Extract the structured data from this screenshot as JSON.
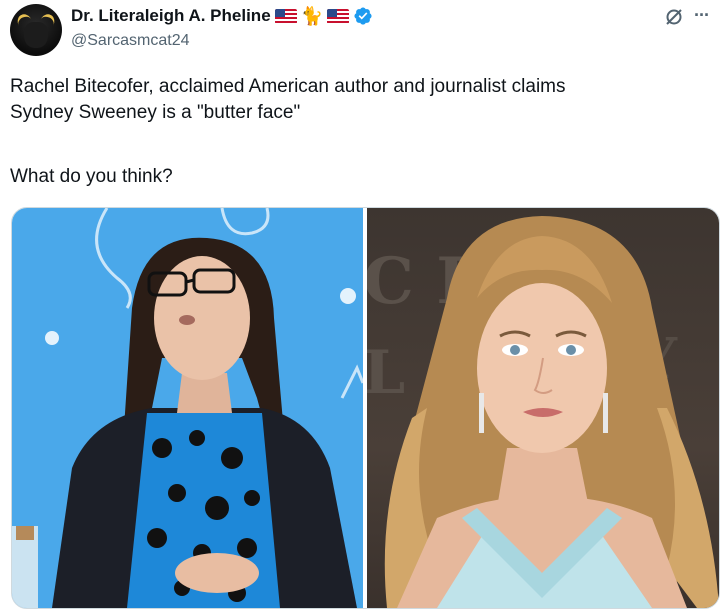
{
  "author": {
    "display_name": "Dr. Literaleigh A. Pheline",
    "handle": "@Sarcasmcat24",
    "name_emoji": [
      "us-flag",
      "cat-emoji",
      "us-flag"
    ],
    "verified": true
  },
  "tweet": {
    "line1": "Rachel Bitecofer, acclaimed American author and journalist claims",
    "line2": "Sydney Sweeney is a \"butter face\"",
    "line3": "What do you think?"
  },
  "media": {
    "count": 2,
    "left_photo": "woman-with-glasses-speaking-photo",
    "right_photo": "blonde-woman-red-carpet-photo",
    "backdrop_letters": "C E L"
  },
  "colors": {
    "verified_blue": "#1d9bf0",
    "text_primary": "#0f1419",
    "text_secondary": "#536471",
    "left_bg": "#4aa8ea"
  },
  "icons": {
    "grok": "grok-icon",
    "more": "more-options-icon"
  }
}
